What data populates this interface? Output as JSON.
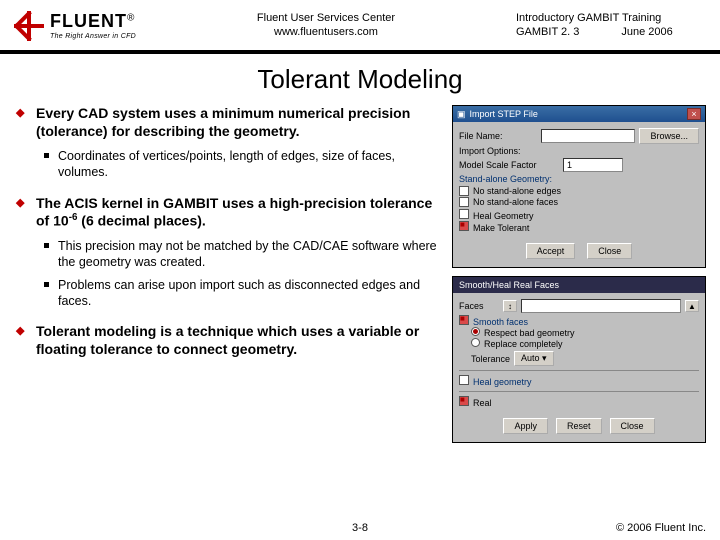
{
  "header": {
    "logo": {
      "word": "FLUENT",
      "reg": "®",
      "tagline": "The Right Answer in CFD"
    },
    "center_line1": "Fluent User Services Center",
    "center_line2": "www.fluentusers.com",
    "right_line1": "Introductory GAMBIT Training",
    "right_line2_left": "GAMBIT 2. 3",
    "right_line2_right": "June 2006"
  },
  "title": "Tolerant Modeling",
  "bullets": {
    "b1": "Every CAD system uses a minimum numerical precision (tolerance) for describing the geometry.",
    "b1_s1": "Coordinates of vertices/points, length of edges, size of faces, volumes.",
    "b2_pre": "The ACIS kernel in GAMBIT uses a high-precision tolerance of 10",
    "b2_sup": "-6",
    "b2_post": " (6 decimal places).",
    "b2_s1": "This precision may not be matched by the CAD/CAE software where the geometry was created.",
    "b2_s2": "Problems can arise upon import such as disconnected edges and faces.",
    "b3": "Tolerant modeling is a technique which uses a variable or floating tolerance to connect geometry."
  },
  "dialog1": {
    "title": "Import STEP File",
    "close": "×",
    "file_label": "File Name:",
    "browse": "Browse...",
    "options_label": "Import Options:",
    "scale_label": "Model Scale Factor",
    "scale_value": "1",
    "standalone_header": "Stand-alone Geometry:",
    "sa1": "No stand-alone edges",
    "sa2": "No stand-alone faces",
    "heal": "Heal Geometry",
    "tolerant": "Make Tolerant",
    "accept": "Accept",
    "close_btn": "Close"
  },
  "dialog2": {
    "title": "Smooth/Heal Real Faces",
    "faces_label": "Faces",
    "pick": "↕",
    "smooth_hdr": "Smooth faces",
    "sm_r1": "Respect bad geometry",
    "sm_r2": "Replace completely",
    "tol_label": "Tolerance",
    "tol_mode": "Auto ▾",
    "heal_hdr": "Heal geometry",
    "real_label": "Real",
    "apply": "Apply",
    "reset": "Reset",
    "close": "Close"
  },
  "footer": {
    "page": "3-8",
    "copyright": "© 2006 Fluent Inc."
  }
}
